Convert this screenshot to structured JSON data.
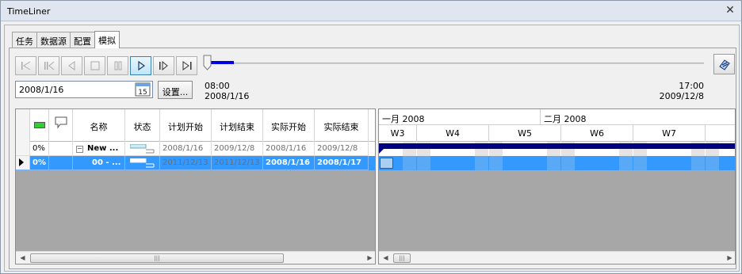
{
  "window": {
    "title": "TimeLiner"
  },
  "tabs": [
    {
      "label": "任务"
    },
    {
      "label": "数据源"
    },
    {
      "label": "配置"
    },
    {
      "label": "模拟"
    }
  ],
  "simulation": {
    "current_date": "2008/1/16",
    "settings_label": "设置...",
    "start_time": "08:00",
    "start_date": "2008/1/16",
    "end_time": "17:00",
    "end_date": "2009/12/8",
    "progress_fraction": 0.05,
    "calendar_day": "15"
  },
  "grid": {
    "columns": [
      "",
      "",
      "名称",
      "状态",
      "计划开始",
      "计划结束",
      "实际开始",
      "实际结束"
    ],
    "rows": [
      {
        "progress": "0%",
        "name": "New ...",
        "plan_start": "2008/1/16",
        "plan_end": "2009/12/8",
        "actual_start": "2008/1/16",
        "actual_end": "2009/12/8"
      },
      {
        "progress": "0%",
        "name": "00 - ...",
        "plan_start": "2011/12/13",
        "plan_end": "2011/12/13",
        "actual_start": "2008/1/16",
        "actual_end": "2008/1/17"
      }
    ]
  },
  "gantt": {
    "months": [
      "一月 2008",
      "二月 2008"
    ],
    "weeks": [
      "W3",
      "W4",
      "W5",
      "W6",
      "W7"
    ]
  },
  "colors": {
    "accent": "#3399ff",
    "bar": "#000080",
    "progress": "#0000e0"
  }
}
